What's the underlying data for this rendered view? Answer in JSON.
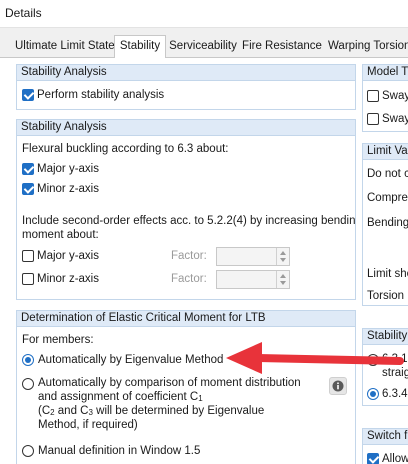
{
  "window": {
    "title": "Details"
  },
  "tabs": [
    {
      "label": "Ultimate Limit State"
    },
    {
      "label": "Stability"
    },
    {
      "label": "Serviceability"
    },
    {
      "label": "Fire Resistance"
    },
    {
      "label": "Warping Torsion"
    }
  ],
  "stability_analysis_1": {
    "title": "Stability Analysis",
    "perform_label": "Perform stability analysis",
    "perform_checked": true
  },
  "stability_analysis_2": {
    "title": "Stability Analysis",
    "flexural_label": "Flexural buckling according to 6.3 about:",
    "major_label": "Major y-axis",
    "major_checked": true,
    "minor_label": "Minor z-axis",
    "minor_checked": true,
    "second_order_line1": "Include second-order effects acc. to 5.2.2(4) by increasing bending",
    "second_order_line2": "moment about:",
    "so_major_label": "Major y-axis",
    "so_major_checked": false,
    "so_minor_label": "Minor z-axis",
    "so_minor_checked": false,
    "factor_label_1": "Factor:",
    "factor_label_2": "Factor:"
  },
  "ltb": {
    "title": "Determination of Elastic Critical Moment for LTB",
    "for_members": "For members:",
    "options": [
      {
        "label": "Automatically by Eigenvalue Method",
        "selected": true
      },
      {
        "line1": "Automatically by comparison of moment distribution",
        "line2": "and assignment of coefficient C",
        "line2_sub": "1",
        "line3_a": "(C",
        "line3_sub1": "2",
        "line3_b": " and C",
        "line3_sub2": "3",
        "line3_c": " will be determined by Eigenvalue",
        "line4": "Method, if required)",
        "selected": false
      },
      {
        "label": "Manual definition in Window 1.5",
        "selected": false
      }
    ]
  },
  "right_panel": {
    "model_type": {
      "title": "Model Ty",
      "opt1": "Sway",
      "opt2": "Sway"
    },
    "limit_values": {
      "title": "Limit Valu",
      "row1": "Do not c",
      "row2": "Compres",
      "row3": "Bending",
      "row4": "Limit shea",
      "row5": "Torsion"
    },
    "stability_a": {
      "title": "Stability A",
      "opt1_a": "6.3.1",
      "opt1_b": "straig",
      "opt2": "6.3.4"
    },
    "switch": {
      "title": "Switch f",
      "opt1": "Allow"
    }
  },
  "colors": {
    "accent": "#1f6fc5",
    "group_header": "#dfeaf7",
    "arrow": "#e8333a"
  }
}
